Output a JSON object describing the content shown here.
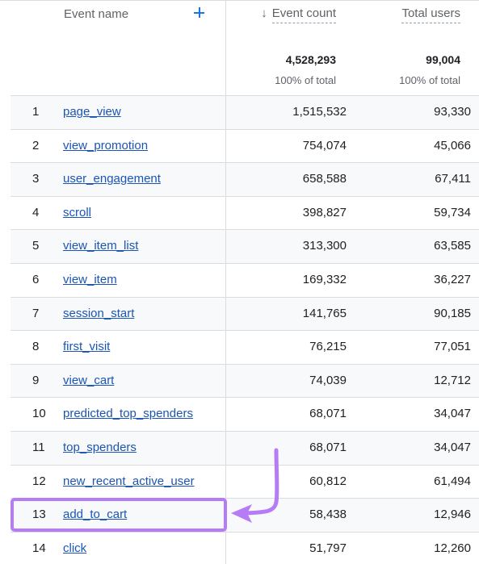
{
  "header": {
    "dimension_label": "Event name",
    "add_dimension_icon": "plus-icon",
    "sort_icon": "arrow-down-icon",
    "sort_glyph": "↓",
    "metrics": [
      {
        "label": "Event count",
        "sorted": "descending"
      },
      {
        "label": "Total users"
      }
    ]
  },
  "totals": {
    "event_count": "4,528,293",
    "event_count_pct": "100% of total",
    "total_users": "99,004",
    "total_users_pct": "100% of total"
  },
  "rows": [
    {
      "index": "1",
      "event_name": "page_view",
      "event_count": "1,515,532",
      "total_users": "93,330"
    },
    {
      "index": "2",
      "event_name": "view_promotion",
      "event_count": "754,074",
      "total_users": "45,066"
    },
    {
      "index": "3",
      "event_name": "user_engagement",
      "event_count": "658,588",
      "total_users": "67,411"
    },
    {
      "index": "4",
      "event_name": "scroll",
      "event_count": "398,827",
      "total_users": "59,734"
    },
    {
      "index": "5",
      "event_name": "view_item_list",
      "event_count": "313,300",
      "total_users": "63,585"
    },
    {
      "index": "6",
      "event_name": "view_item",
      "event_count": "169,332",
      "total_users": "36,227"
    },
    {
      "index": "7",
      "event_name": "session_start",
      "event_count": "141,765",
      "total_users": "90,185"
    },
    {
      "index": "8",
      "event_name": "first_visit",
      "event_count": "76,215",
      "total_users": "77,051"
    },
    {
      "index": "9",
      "event_name": "view_cart",
      "event_count": "74,039",
      "total_users": "12,712"
    },
    {
      "index": "10",
      "event_name": "predicted_top_spenders",
      "event_count": "68,071",
      "total_users": "34,047"
    },
    {
      "index": "11",
      "event_name": "top_spenders",
      "event_count": "68,071",
      "total_users": "34,047"
    },
    {
      "index": "12",
      "event_name": "new_recent_active_user",
      "event_count": "60,812",
      "total_users": "61,494"
    },
    {
      "index": "13",
      "event_name": "add_to_cart",
      "event_count": "58,438",
      "total_users": "12,946"
    },
    {
      "index": "14",
      "event_name": "click",
      "event_count": "51,797",
      "total_users": "12,260"
    }
  ],
  "annotation": {
    "highlighted_row_index": "13",
    "color": "#b57cf5",
    "arrow_icon": "curved-arrow-icon"
  },
  "colors": {
    "link": "#1a55b5",
    "accent": "#1a73e8",
    "stripe": "#f8f9fa",
    "border": "#dadce0"
  }
}
